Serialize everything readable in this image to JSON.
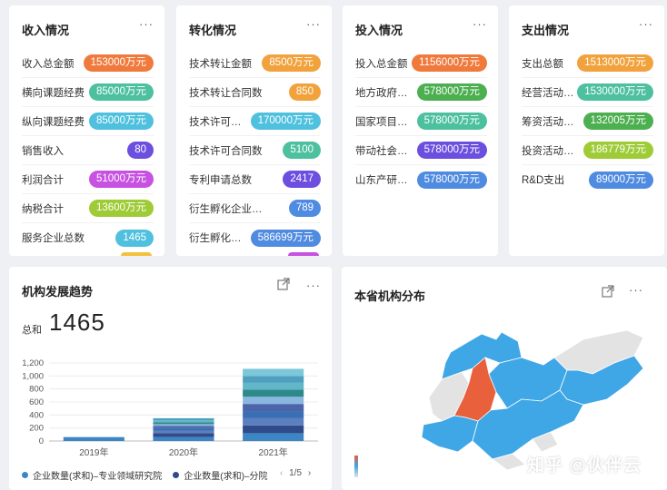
{
  "cards": [
    {
      "title": "收入情况",
      "rows": [
        {
          "label": "收入总金额",
          "value": "153000万元",
          "color": "#f07a3c"
        },
        {
          "label": "横向课题经费",
          "value": "85000万元",
          "color": "#4dc0a0"
        },
        {
          "label": "纵向课题经费",
          "value": "85000万元",
          "color": "#4fc1de"
        },
        {
          "label": "销售收入",
          "value": "80",
          "color": "#6d4fe0"
        },
        {
          "label": "利润合计",
          "value": "51000万元",
          "color": "#c751e0"
        },
        {
          "label": "纳税合计",
          "value": "13600万元",
          "color": "#9ecb36"
        },
        {
          "label": "服务企业总数",
          "value": "1465",
          "color": "#4fc1de"
        }
      ]
    },
    {
      "title": "转化情况",
      "rows": [
        {
          "label": "技术转让金额",
          "value": "8500万元",
          "color": "#f2a23c"
        },
        {
          "label": "技术转让合同数",
          "value": "850",
          "color": "#f2a23c"
        },
        {
          "label": "技术许可金额",
          "value": "170000万元",
          "color": "#4fc1de"
        },
        {
          "label": "技术许可合同数",
          "value": "5100",
          "color": "#4dc0a0"
        },
        {
          "label": "专利申请总数",
          "value": "2417",
          "color": "#6d4fe0"
        },
        {
          "label": "衍生孵化企业总数",
          "value": "789",
          "color": "#4f8be0"
        },
        {
          "label": "衍生孵化企业营收",
          "value": "586699万元",
          "color": "#4f8be0"
        }
      ]
    },
    {
      "title": "投入情况",
      "rows": [
        {
          "label": "投入总金额",
          "value": "1156000万元",
          "color": "#f07a3c"
        },
        {
          "label": "地方政府投入",
          "value": "578000万元",
          "color": "#4caf50"
        },
        {
          "label": "国家项目投入",
          "value": "578000万元",
          "color": "#4dc0a0"
        },
        {
          "label": "带动社会投资",
          "value": "578000万元",
          "color": "#6d4fe0"
        },
        {
          "label": "山东产研院投入",
          "value": "578000万元",
          "color": "#4f8be0"
        }
      ]
    },
    {
      "title": "支出情况",
      "rows": [
        {
          "label": "支出总额",
          "value": "1513000万元",
          "color": "#f2a23c"
        },
        {
          "label": "经营活动支出",
          "value": "1530000万元",
          "color": "#4dc0a0"
        },
        {
          "label": "筹资活动支出",
          "value": "132005万元",
          "color": "#4caf50"
        },
        {
          "label": "投资活动支出",
          "value": "186779万元",
          "color": "#9ecb36"
        },
        {
          "label": "R&D支出",
          "value": "89000万元",
          "color": "#4f8be0"
        }
      ]
    }
  ],
  "trend": {
    "title": "机构发展趋势",
    "sum_label": "总和",
    "sum_value": "1465",
    "legend": [
      {
        "name": "企业数量(求和)–专业领域研究院",
        "color": "#3d86c6"
      },
      {
        "name": "企业数量(求和)–分院",
        "color": "#2f4b8a"
      }
    ],
    "pager": "1/5"
  },
  "map": {
    "title": "本省机构分布",
    "colors": {
      "high": "#e8603c",
      "mid": "#3fa7e6",
      "low": "#e3e3e3"
    }
  },
  "chart_data": {
    "type": "bar",
    "stacked": true,
    "categories": [
      "2019年",
      "2020年",
      "2021年"
    ],
    "yticks": [
      "0",
      "200",
      "400",
      "600",
      "800",
      "1,000",
      "1,200"
    ],
    "ylim": [
      0,
      1200
    ],
    "grid": true,
    "series": [
      {
        "name": "企业数量(求和)–专业领域研究院",
        "values": [
          60,
          60,
          120
        ],
        "color": "#3d86c6"
      },
      {
        "name": "企业数量(求和)–分院",
        "values": [
          0,
          60,
          120
        ],
        "color": "#2f4b8a"
      },
      {
        "values": [
          0,
          40,
          110
        ],
        "color": "#5b7fbf"
      },
      {
        "values": [
          0,
          40,
          110
        ],
        "color": "#3a6fb5"
      },
      {
        "values": [
          0,
          30,
          110
        ],
        "color": "#4c64a8"
      },
      {
        "values": [
          0,
          30,
          110
        ],
        "color": "#8ab6e0"
      },
      {
        "values": [
          0,
          30,
          110
        ],
        "color": "#2e8a8a"
      },
      {
        "values": [
          0,
          30,
          110
        ],
        "color": "#63b5c8"
      },
      {
        "values": [
          0,
          30,
          100
        ],
        "color": "#4fa0c0"
      },
      {
        "values": [
          0,
          0,
          110
        ],
        "color": "#7cc8d8"
      }
    ]
  },
  "watermark": "知乎 @伙伴云"
}
